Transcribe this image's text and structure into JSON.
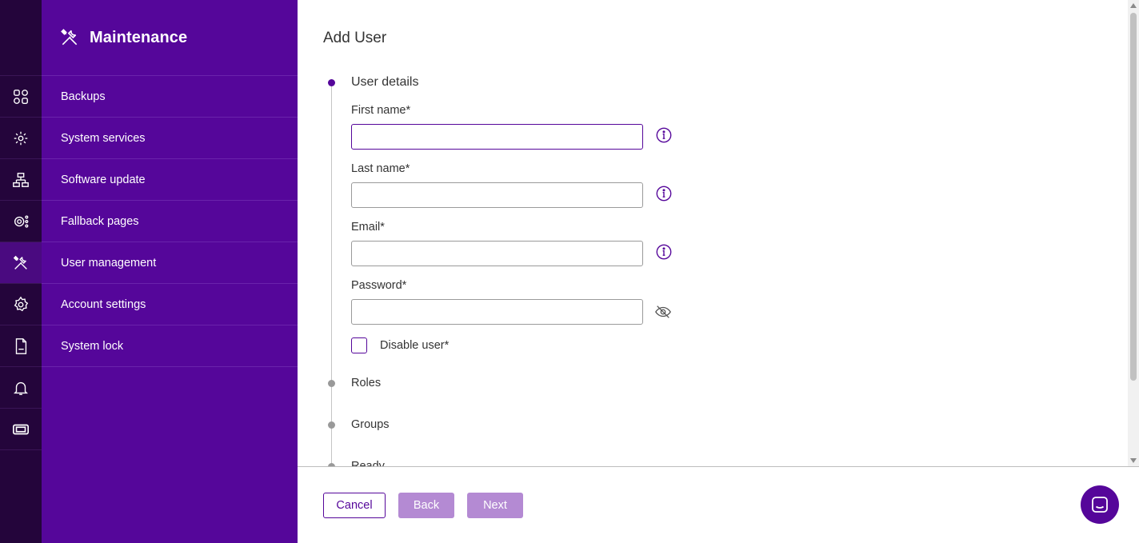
{
  "menu": {
    "title": "Maintenance",
    "items": [
      {
        "label": "Backups",
        "icon": "grid-icon"
      },
      {
        "label": "System services",
        "icon": "gear-network-icon"
      },
      {
        "label": "Software update",
        "icon": "network-icon"
      },
      {
        "label": "Fallback pages",
        "icon": "gear-dots-icon"
      },
      {
        "label": "User management",
        "icon": "tools-icon"
      },
      {
        "label": "Account settings",
        "icon": "gear-icon"
      },
      {
        "label": "System lock",
        "icon": "log-file-icon"
      }
    ],
    "extra_rail_icons": [
      "bell-icon",
      "ticket-icon"
    ]
  },
  "page": {
    "title": "Add User"
  },
  "steps": [
    {
      "label": "User details",
      "active": true
    },
    {
      "label": "Roles",
      "active": false
    },
    {
      "label": "Groups",
      "active": false
    },
    {
      "label": "Ready",
      "active": false
    }
  ],
  "form": {
    "first_name": {
      "label": "First name*",
      "value": ""
    },
    "last_name": {
      "label": "Last name*",
      "value": ""
    },
    "email": {
      "label": "Email*",
      "value": ""
    },
    "password": {
      "label": "Password*",
      "value": ""
    },
    "disable_user": {
      "label": "Disable user*",
      "checked": false
    }
  },
  "footer": {
    "cancel_label": "Cancel",
    "back_label": "Back",
    "next_label": "Next"
  },
  "colors": {
    "rail": "#24053b",
    "menu": "#55069a",
    "accent": "#55069a",
    "disabled_button": "#b48ad3"
  }
}
